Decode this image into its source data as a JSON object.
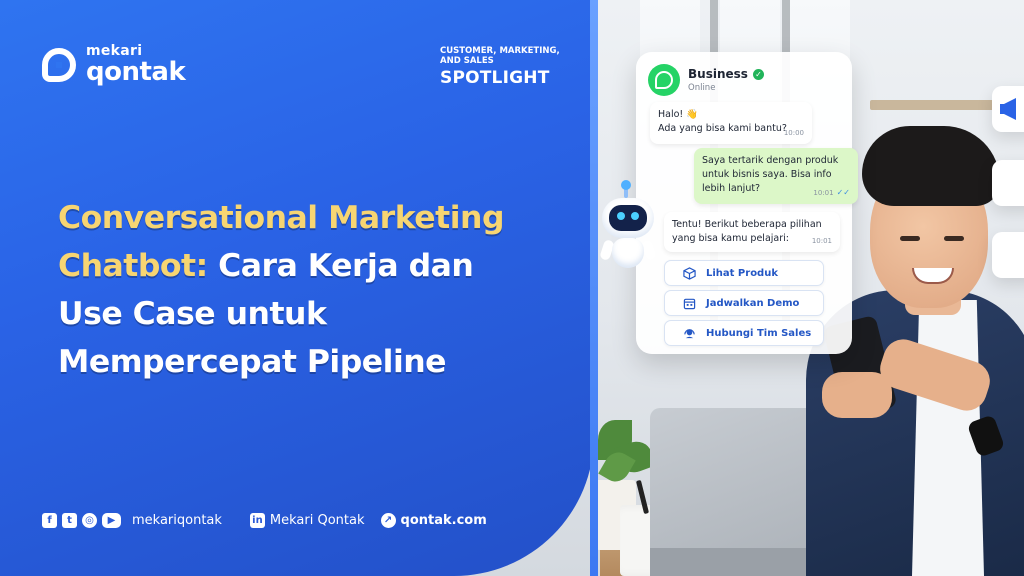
{
  "brand": {
    "top": "mekari",
    "bottom": "qontak"
  },
  "spotlight": {
    "sub": "CUSTOMER, MARKETING, AND SALES",
    "main": "SPOTLIGHT"
  },
  "headline": {
    "yellow_1": "Conversational Marketing",
    "yellow_2": "Chatbot:",
    "white_1": " Cara Kerja dan",
    "white_2": "Use Case untuk",
    "white_3": "Mempercepat Pipeline"
  },
  "footer": {
    "social_icons": [
      "facebook-icon",
      "twitter-icon",
      "instagram-icon",
      "youtube-icon"
    ],
    "social_handle": "mekariqontak",
    "linkedin_name": "Mekari Qontak",
    "website": "qontak.com"
  },
  "chat": {
    "business_name": "Business",
    "status": "Online",
    "messages": [
      {
        "text_1": "Halo! 👋",
        "text_2": "Ada yang bisa kami bantu?",
        "time": "10:00"
      },
      {
        "text_1": "Saya tertarik dengan produk",
        "text_2": "untuk bisnis saya. Bisa info",
        "text_3": "lebih lanjut?",
        "time": "10:01"
      },
      {
        "text_1": "Tentu! Berikut beberapa pilihan",
        "text_2": "yang bisa kamu pelajari:",
        "time": "10:01"
      }
    ],
    "options": [
      "Lihat Produk",
      "Jadwalkan Demo",
      "Hubungi Tim Sales"
    ]
  },
  "colors": {
    "panel_blue": "#2a63e6",
    "headline_yellow": "#f7d572",
    "whatsapp_green": "#25d366",
    "option_blue": "#2457c5"
  }
}
